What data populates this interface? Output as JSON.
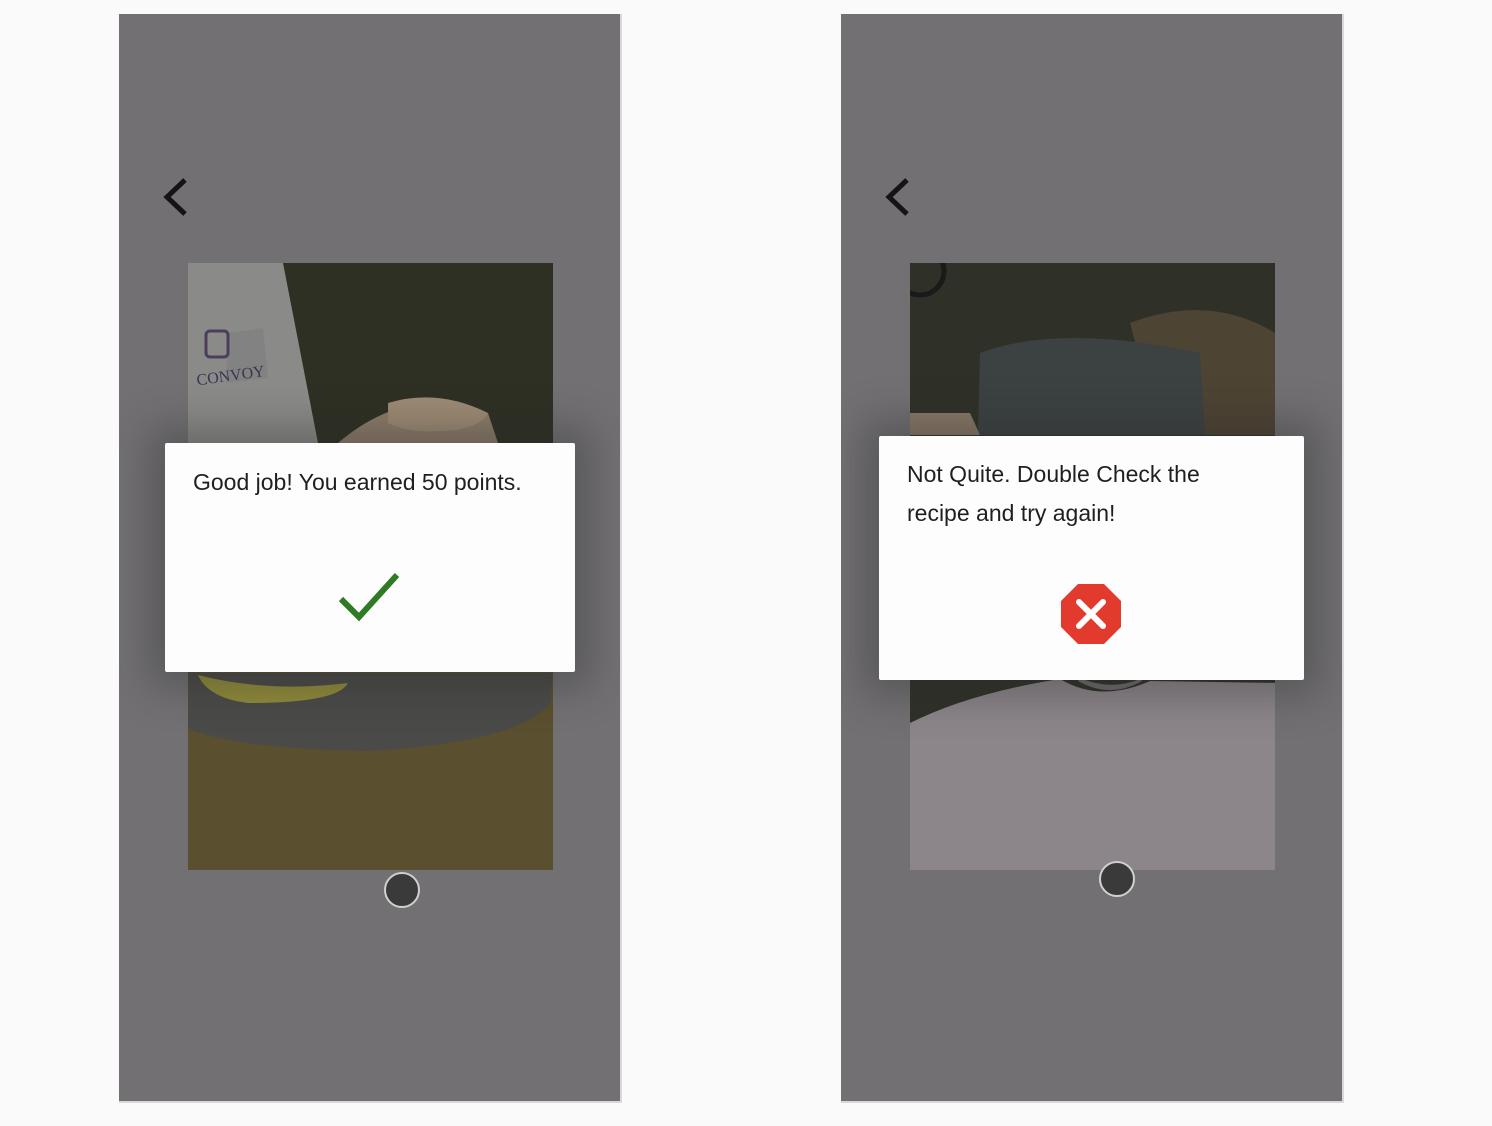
{
  "screens": [
    {
      "icons": {
        "back": "chevron-left-icon",
        "status": "checkmark-icon"
      },
      "modal": {
        "message": "Good job! You earned 50 points."
      },
      "colors": {
        "status": "#2f7a25"
      }
    },
    {
      "icons": {
        "back": "chevron-left-icon",
        "status": "stop-x-icon"
      },
      "modal": {
        "message": "Not Quite. Double Check the recipe and try again!"
      },
      "colors": {
        "status": "#e23b2e"
      }
    }
  ]
}
